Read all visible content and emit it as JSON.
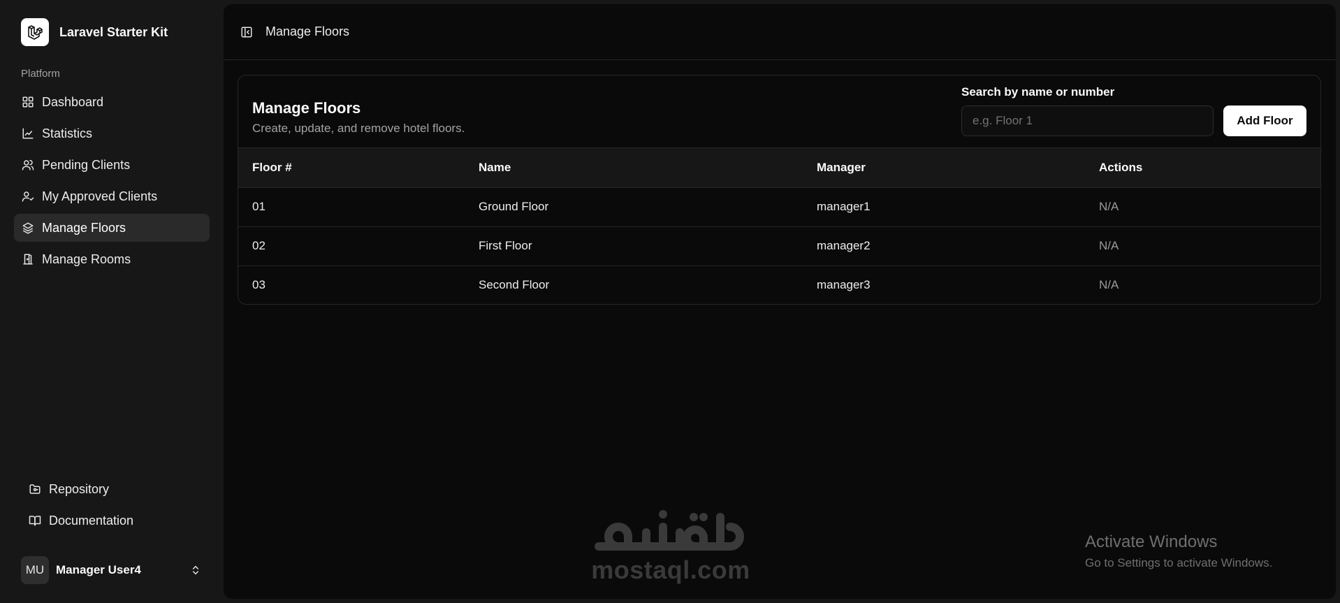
{
  "sidebar": {
    "brand": {
      "name": "Laravel Starter Kit",
      "icon": "laravel-logo-icon"
    },
    "group_label": "Platform",
    "items": [
      {
        "label": "Dashboard",
        "icon": "layout-grid-icon",
        "active": false
      },
      {
        "label": "Statistics",
        "icon": "chart-line-icon",
        "active": false
      },
      {
        "label": "Pending Clients",
        "icon": "users-icon",
        "active": false
      },
      {
        "label": "My Approved Clients",
        "icon": "user-check-icon",
        "active": false
      },
      {
        "label": "Manage Floors",
        "icon": "layers-icon",
        "active": true
      },
      {
        "label": "Manage Rooms",
        "icon": "door-icon",
        "active": false
      }
    ],
    "footer_links": [
      {
        "label": "Repository",
        "icon": "folder-git-icon"
      },
      {
        "label": "Documentation",
        "icon": "book-open-icon"
      }
    ],
    "user": {
      "initials": "MU",
      "name": "Manager User4",
      "icon": "chevrons-up-down-icon"
    }
  },
  "topbar": {
    "breadcrumb": "Manage Floors",
    "toggle_icon": "panel-left-icon"
  },
  "card": {
    "title": "Manage Floors",
    "subtitle": "Create, update, and remove hotel floors.",
    "search": {
      "label": "Search by name or number",
      "placeholder": "e.g. Floor 1",
      "value": ""
    },
    "add_button": "Add Floor"
  },
  "table": {
    "headers": [
      "Floor #",
      "Name",
      "Manager",
      "Actions"
    ],
    "rows": [
      [
        "01",
        "Ground Floor",
        "manager1",
        "N/A"
      ],
      [
        "02",
        "First Floor",
        "manager2",
        "N/A"
      ],
      [
        "03",
        "Second Floor",
        "manager3",
        "N/A"
      ]
    ]
  },
  "watermark": {
    "logo_text": "مستقل",
    "domain": "mostaql.com"
  },
  "windows_notice": {
    "title": "Activate Windows",
    "subtitle": "Go to Settings to activate Windows."
  },
  "colors": {
    "background": "#171717",
    "main": "#0a0a0a",
    "border": "#262626",
    "active": "#2a2a2a",
    "button": "#ffffff"
  }
}
